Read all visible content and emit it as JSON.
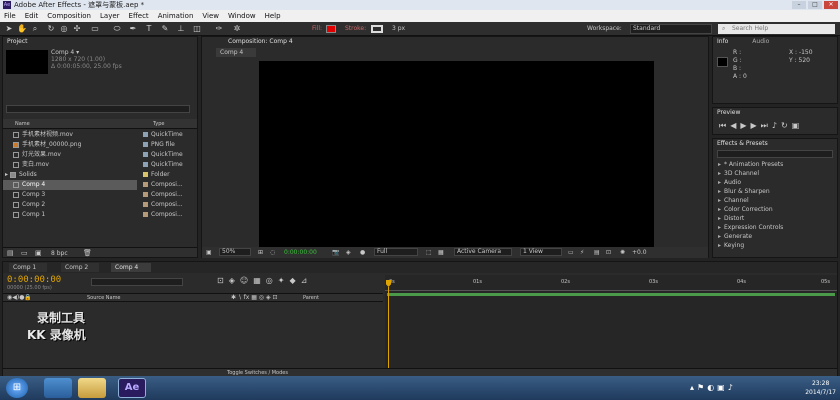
{
  "window": {
    "title": "Adobe After Effects - 遮罩与蒙板.aep *",
    "min": "–",
    "max": "□",
    "close": "✕"
  },
  "menu": [
    "File",
    "Edit",
    "Composition",
    "Layer",
    "Effect",
    "Animation",
    "View",
    "Window",
    "Help"
  ],
  "toolbar": {
    "fill_label": "Fill:",
    "stroke_label": "Stroke:",
    "stroke_px": "3 px",
    "workspace_label": "Workspace:",
    "workspace_value": "Standard",
    "search_placeholder": "Search Help",
    "fill_color": "#e00000"
  },
  "project": {
    "tab": "Project",
    "comp_name": "Comp 4 ▾",
    "comp_info1": "1280 x 720 (1.00)",
    "comp_info2": "Δ 0:00:05:00, 25.00 fps",
    "col_name": "Name",
    "col_type": "Type",
    "bpc": "8 bpc",
    "items": [
      {
        "name": "手机素材视频.mov",
        "type": "QuickTime",
        "color": "#8ea2b5"
      },
      {
        "name": "手机素材_00000.png",
        "type": "PNG file",
        "color": "#8ea2b5"
      },
      {
        "name": "灯光效果.mov",
        "type": "QuickTime",
        "color": "#8ea2b5"
      },
      {
        "name": "变白.mov",
        "type": "QuickTime",
        "color": "#8ea2b5"
      },
      {
        "name": "Solids",
        "type": "Folder",
        "color": "#d8c36a"
      },
      {
        "name": "Comp 4",
        "type": "Composi...",
        "color": "#b59a7a"
      },
      {
        "name": "Comp 3",
        "type": "Composi...",
        "color": "#b59a7a"
      },
      {
        "name": "Comp 2",
        "type": "Composi...",
        "color": "#b59a7a"
      },
      {
        "name": "Comp 1",
        "type": "Composi...",
        "color": "#b59a7a"
      }
    ]
  },
  "comp_viewer": {
    "tab": "Composition: Comp 4",
    "subtab": "Comp 4",
    "zoom": "50%",
    "time": "0:00:00:00",
    "quality": "Full",
    "camera": "Active Camera",
    "views": "1 View",
    "offset": "+0.0"
  },
  "info": {
    "tab": "Info",
    "tab2": "Audio",
    "r": "R :",
    "g": "G :",
    "b": "B :",
    "a": "A : 0",
    "x": "X : -150",
    "y": "Y : 520"
  },
  "preview": {
    "tab": "Preview"
  },
  "effects": {
    "tab": "Effects & Presets",
    "items": [
      "* Animation Presets",
      "3D Channel",
      "Audio",
      "Blur & Sharpen",
      "Channel",
      "Color Correction",
      "Distort",
      "Expression Controls",
      "Generate",
      "Keying"
    ]
  },
  "timeline": {
    "tabs": [
      "Comp 1",
      "Comp 2",
      "Comp 4"
    ],
    "timecode": "0:00:00:00",
    "fps_note": "00000 (25.00 fps)",
    "source_name": "Source Name",
    "parent": "Parent",
    "ticks": [
      "0s",
      "01s",
      "02s",
      "03s",
      "04s",
      "05s"
    ],
    "toggle": "Toggle Switches / Modes"
  },
  "watermark": {
    "line1": "录制工具",
    "line2": "KK 录像机"
  },
  "taskbar": {
    "time": "23:28",
    "date": "2014/7/17",
    "ae_label": "Ae"
  }
}
